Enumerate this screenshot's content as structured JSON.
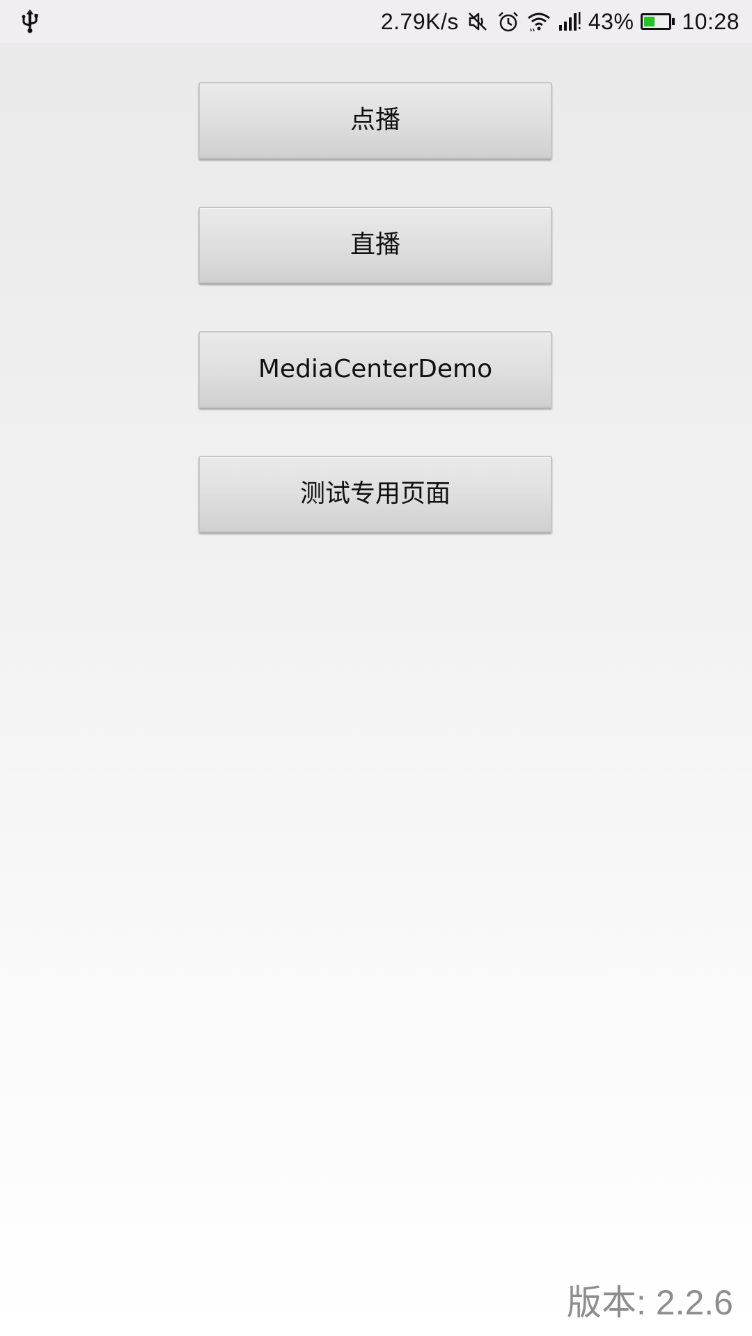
{
  "status_bar": {
    "network_speed": "2.79K/s",
    "battery_percent": "43%",
    "battery_level": 0.43,
    "time": "10:28",
    "icons": [
      "usb-icon",
      "mute-icon",
      "alarm-icon",
      "wifi-icon",
      "signal-icon",
      "battery-icon"
    ],
    "battery_color": "#22c322"
  },
  "menu": {
    "buttons": [
      {
        "label": "点播"
      },
      {
        "label": "直播"
      },
      {
        "label": "MediaCenterDemo"
      },
      {
        "label": "测试专用页面"
      }
    ]
  },
  "footer": {
    "version": "版本: 2.2.6"
  }
}
